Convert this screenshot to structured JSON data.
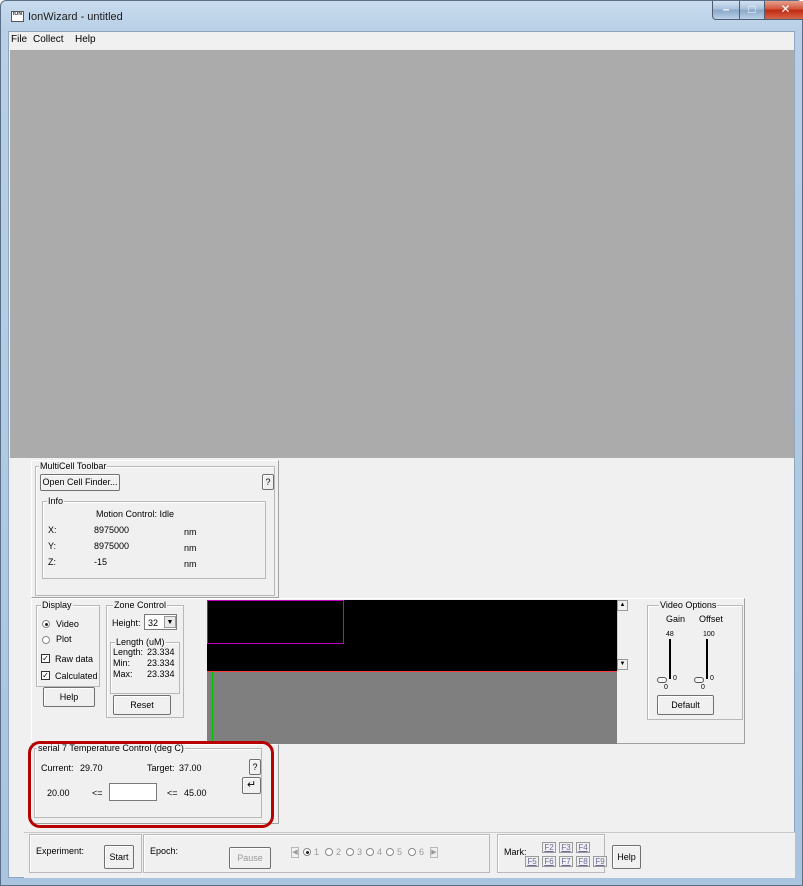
{
  "window": {
    "title": "IonWizard - untitled",
    "icon_text": "ION"
  },
  "menu": [
    "File",
    "Collect",
    "Help"
  ],
  "multicell": {
    "title": "MultiCell Toolbar",
    "open_finder": "Open Cell Finder...",
    "help": "?",
    "info_title": "Info",
    "motion_status": "Motion Control: Idle",
    "rows": [
      {
        "label": "X:",
        "value": "8975000",
        "unit": "nm"
      },
      {
        "label": "Y:",
        "value": "8975000",
        "unit": "nm"
      },
      {
        "label": "Z:",
        "value": "-15",
        "unit": "nm"
      }
    ]
  },
  "display": {
    "title": "Display",
    "video": "Video",
    "plot": "Plot",
    "raw": "Raw data",
    "calculated": "Calculated",
    "help": "Help",
    "selected": "Video"
  },
  "zone": {
    "title": "Zone Control",
    "height_label": "Height:",
    "height_value": "32",
    "length_title": "Length (uM)",
    "length_label": "Length:",
    "length_value": "23.334",
    "min_label": "Min:",
    "min_value": "23.334",
    "max_label": "Max:",
    "max_value": "23.334",
    "reset": "Reset"
  },
  "video_options": {
    "title": "Video Options",
    "gain_label": "Gain",
    "offset_label": "Offset",
    "gain_max": "48",
    "gain_min": "0",
    "gain_value": "0",
    "offset_max": "100",
    "offset_min": "0",
    "offset_value": "0",
    "default": "Default"
  },
  "temperature": {
    "title": "serial 7 Temperature Control (deg C)",
    "current_label": "Current:",
    "current_value": "29.70",
    "target_label": "Target:",
    "target_value": "37.00",
    "min_value": "20.00",
    "lte1": "<=",
    "lte2": "<=",
    "max_value": "45.00",
    "input_value": "",
    "help": "?",
    "enter": "↵"
  },
  "bottom": {
    "experiment_label": "Experiment:",
    "start": "Start",
    "epoch_label": "Epoch:",
    "pause": "Pause",
    "epochs": [
      "1",
      "2",
      "3",
      "4",
      "5",
      "6"
    ],
    "mark_label": "Mark:",
    "fkeys": [
      "F2",
      "F3",
      "F4",
      "F5",
      "F6",
      "F7",
      "F8",
      "F9"
    ],
    "help": "Help"
  },
  "colors": {
    "highlight": "#b80000",
    "video_strip": "#000000",
    "zone_box": "#c000c0",
    "baseline": "#ff0000",
    "cursor": "#00c000"
  }
}
